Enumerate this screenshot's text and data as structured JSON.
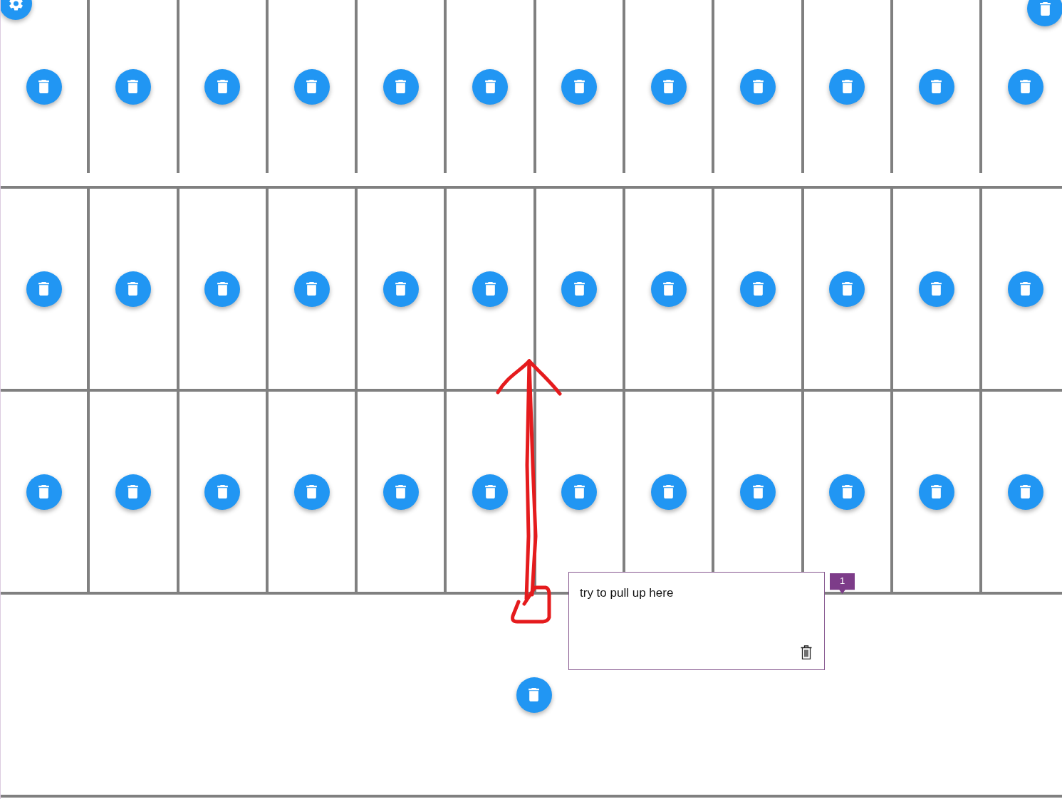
{
  "floating_buttons": [
    {
      "kind": "settings_button"
    },
    {
      "kind": "delete_button"
    }
  ],
  "grid": {
    "rows": [
      {
        "cells": [
          {
            "kind": "delete_button"
          },
          {
            "kind": "delete_button"
          },
          {
            "kind": "delete_button"
          },
          {
            "kind": "delete_button"
          },
          {
            "kind": "delete_button"
          },
          {
            "kind": "delete_button"
          },
          {
            "kind": "delete_button"
          },
          {
            "kind": "delete_button"
          },
          {
            "kind": "delete_button"
          },
          {
            "kind": "delete_button"
          },
          {
            "kind": "delete_button"
          },
          {
            "kind": "delete_button"
          }
        ]
      },
      {
        "cells": [
          {
            "kind": "delete_button"
          },
          {
            "kind": "delete_button"
          },
          {
            "kind": "delete_button"
          },
          {
            "kind": "delete_button"
          },
          {
            "kind": "delete_button"
          },
          {
            "kind": "delete_button"
          },
          {
            "kind": "delete_button"
          },
          {
            "kind": "delete_button"
          },
          {
            "kind": "delete_button"
          },
          {
            "kind": "delete_button"
          },
          {
            "kind": "delete_button"
          },
          {
            "kind": "delete_button"
          }
        ]
      },
      {
        "cells": [
          {
            "kind": "delete_button"
          },
          {
            "kind": "delete_button"
          },
          {
            "kind": "delete_button"
          },
          {
            "kind": "delete_button"
          },
          {
            "kind": "delete_button"
          },
          {
            "kind": "delete_button"
          },
          {
            "kind": "delete_button"
          },
          {
            "kind": "delete_button"
          },
          {
            "kind": "delete_button"
          },
          {
            "kind": "delete_button"
          },
          {
            "kind": "delete_button"
          },
          {
            "kind": "delete_button"
          }
        ]
      },
      {
        "cells": [
          {
            "kind": "delete_button"
          }
        ]
      }
    ]
  },
  "comment": {
    "text": "try to pull up here",
    "marker": "1"
  }
}
